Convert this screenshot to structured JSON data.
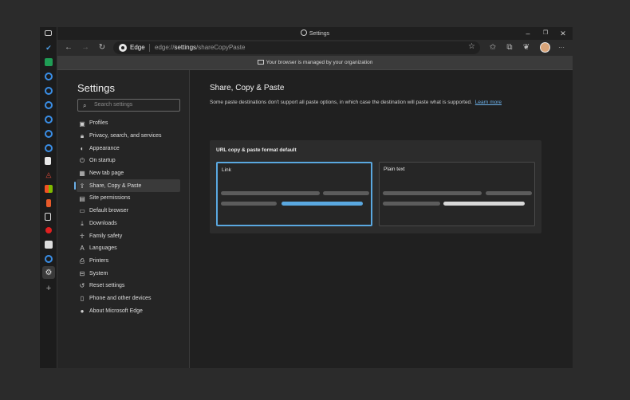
{
  "window": {
    "title": "Settings"
  },
  "titlebar": {
    "minimize": "–",
    "restore": "❐",
    "close": "✕"
  },
  "toolbar": {
    "back": "←",
    "forward": "→",
    "refresh": "↻",
    "brand": "Edge",
    "url_prefix": "edge://",
    "url_bold": "settings",
    "url_suffix": "/shareCopyPaste",
    "star": "☆",
    "favorites": "✩",
    "collections": "⧉",
    "reading": "❦",
    "more": "···"
  },
  "managed_bar": {
    "text": "Your browser is managed by your organization"
  },
  "sidebar": {
    "title": "Settings",
    "search_placeholder": "Search settings",
    "search_icon": "⌕",
    "items": [
      {
        "label": "Profiles",
        "icon": "▣",
        "icon_name": "profiles-icon"
      },
      {
        "label": "Privacy, search, and services",
        "icon": "🔒︎",
        "icon_name": "lock-icon"
      },
      {
        "label": "Appearance",
        "icon": "◐",
        "icon_name": "appearance-icon"
      },
      {
        "label": "On startup",
        "icon": "⏻",
        "icon_name": "power-icon"
      },
      {
        "label": "New tab page",
        "icon": "▦",
        "icon_name": "new-tab-icon"
      },
      {
        "label": "Share, Copy & Paste",
        "icon": "⇪",
        "icon_name": "share-icon"
      },
      {
        "label": "Site permissions",
        "icon": "▤",
        "icon_name": "site-permissions-icon"
      },
      {
        "label": "Default browser",
        "icon": "▭",
        "icon_name": "default-browser-icon"
      },
      {
        "label": "Downloads",
        "icon": "⤓",
        "icon_name": "download-icon"
      },
      {
        "label": "Family safety",
        "icon": "☥",
        "icon_name": "family-icon"
      },
      {
        "label": "Languages",
        "icon": "A",
        "icon_name": "languages-icon"
      },
      {
        "label": "Printers",
        "icon": "⎙",
        "icon_name": "printer-icon"
      },
      {
        "label": "System",
        "icon": "⊟",
        "icon_name": "system-icon"
      },
      {
        "label": "Reset settings",
        "icon": "↺",
        "icon_name": "reset-icon"
      },
      {
        "label": "Phone and other devices",
        "icon": "▯",
        "icon_name": "phone-icon"
      },
      {
        "label": "About Microsoft Edge",
        "icon": "●",
        "icon_name": "edge-logo-icon"
      }
    ]
  },
  "main": {
    "title": "Share, Copy & Paste",
    "description": "Some paste destinations don't support all paste options, in which case the destination will paste what is supported.",
    "learn_more": "Learn more",
    "card_title": "URL copy & paste format default",
    "options": [
      {
        "label": "Link",
        "selected": true
      },
      {
        "label": "Plain text",
        "selected": false
      }
    ]
  },
  "colors": {
    "accent": "#5aa8e0",
    "link": "#6cb0e8",
    "background": "#202020"
  }
}
